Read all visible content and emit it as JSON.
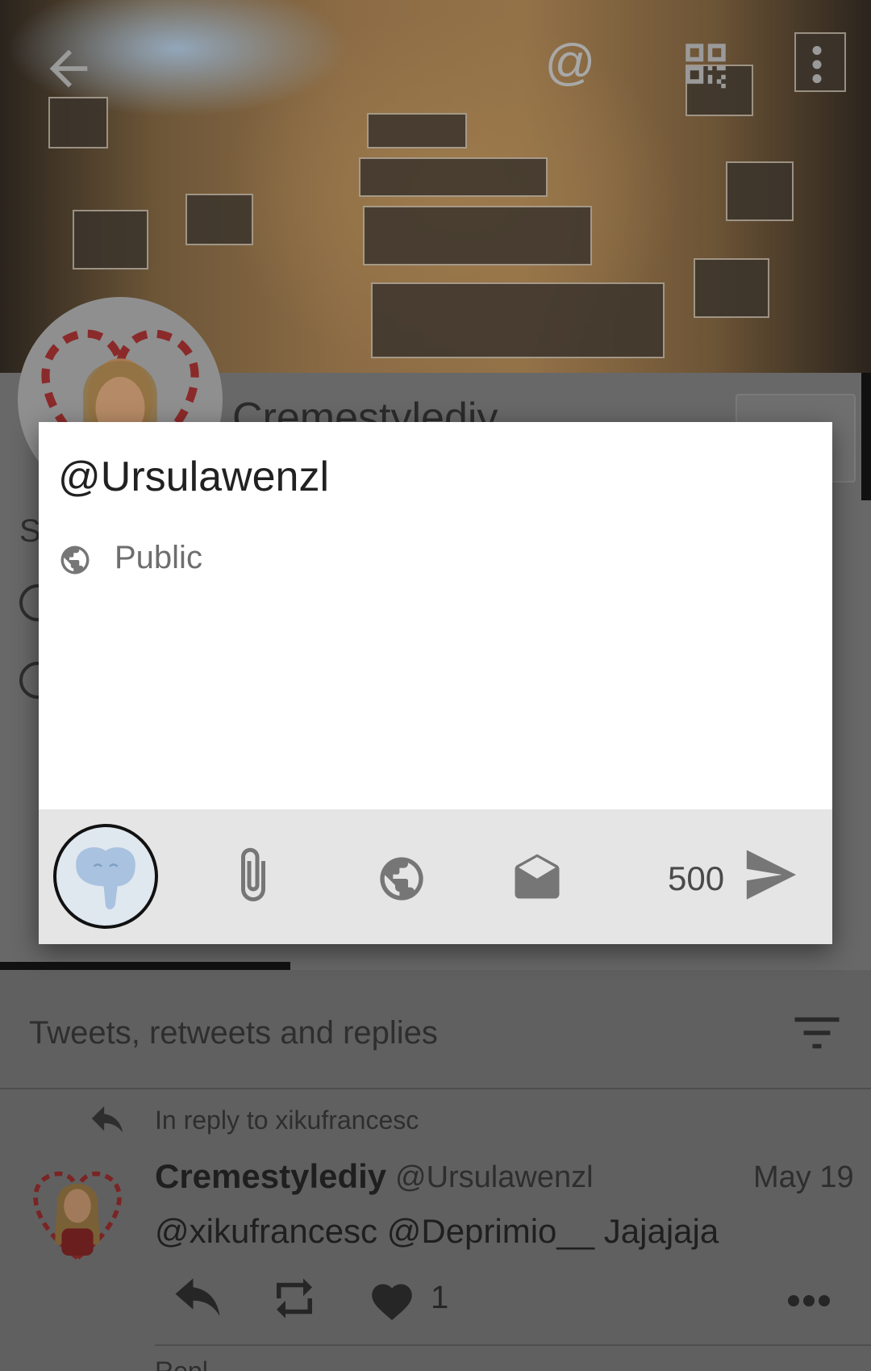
{
  "header": {
    "back_icon": "arrow-left-icon",
    "mention_icon": "at-sign-icon",
    "qr_icon": "qr-code-icon",
    "menu_icon": "more-vertical-icon",
    "mention_label": "@"
  },
  "profile": {
    "display_name": "Cremestylediy",
    "bio_initial": "S"
  },
  "dialog": {
    "recipient": "@Ursulawenzl",
    "visibility_label": "Public",
    "visibility_icon": "globe-icon",
    "char_count": "500",
    "toolbar_icons": [
      "attach-icon",
      "globe-icon",
      "mail-open-icon",
      "send-icon"
    ]
  },
  "timeline": {
    "filter_label": "Tweets, retweets and replies",
    "tweets": [
      {
        "reply_context": "In reply to xikufrancesc",
        "display_name": "Cremestylediy",
        "handle": "@Ursulawenzl",
        "date": "May 19",
        "text": "@xikufrancesc @Deprimio__ Jajajaja",
        "like_count": "1"
      }
    ],
    "next_reply_context": "Repl"
  },
  "colors": {
    "dialog_bg": "#ffffff",
    "toolbar_bg": "#e5e5e5",
    "dim_overlay": "#686868",
    "icon_gray": "#767676"
  }
}
